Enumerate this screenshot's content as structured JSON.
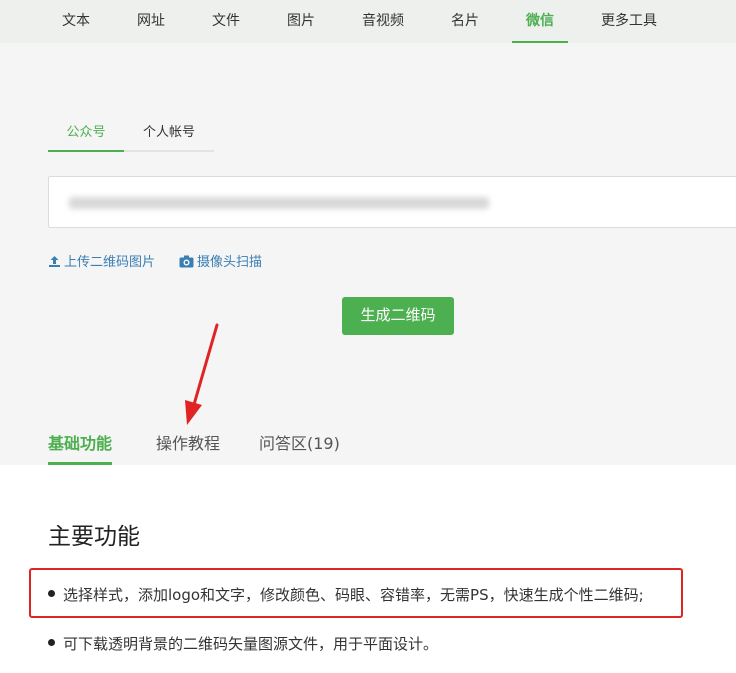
{
  "topnav": {
    "tabs": [
      {
        "label": "文本",
        "active": false
      },
      {
        "label": "网址",
        "active": false
      },
      {
        "label": "文件",
        "active": false
      },
      {
        "label": "图片",
        "active": false
      },
      {
        "label": "音视频",
        "active": false
      },
      {
        "label": "名片",
        "active": false
      },
      {
        "label": "微信",
        "active": true
      },
      {
        "label": "更多工具",
        "active": false
      }
    ]
  },
  "subtabs": [
    {
      "label": "公众号",
      "active": true
    },
    {
      "label": "个人帐号",
      "active": false
    }
  ],
  "input": {
    "value": ""
  },
  "links": {
    "upload": "上传二维码图片",
    "camera": "摄像头扫描"
  },
  "generate_button": "生成二维码",
  "content_tabs": [
    {
      "label": "基础功能",
      "active": true
    },
    {
      "label": "操作教程",
      "active": false
    },
    {
      "label": "问答区(19)",
      "active": false
    }
  ],
  "section_title": "主要功能",
  "features": [
    "选择样式，添加logo和文字，修改颜色、码眼、容错率，无需PS，快速生成个性二维码;",
    "可下载透明背景的二维码矢量图源文件，用于平面设计。"
  ],
  "colors": {
    "accent": "#4CAF50",
    "link": "#3a7fb4",
    "annotation": "#e02424"
  }
}
